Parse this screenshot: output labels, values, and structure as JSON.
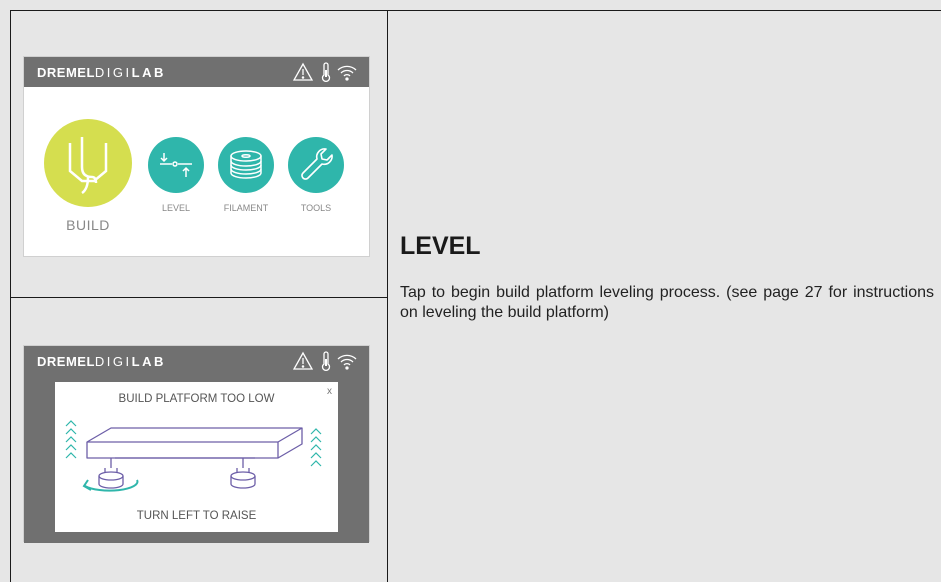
{
  "screen1": {
    "brand_bold": "DREMEL",
    "brand_mid": "DIGI",
    "brand_end": "LAB",
    "status_icons": [
      "warning-icon",
      "thermometer-icon",
      "wifi-icon"
    ],
    "build_label": "BUILD",
    "level_label": "LEVEL",
    "filament_label": "FILAMENT",
    "tools_label": "TOOLS",
    "colors": {
      "build": "#d5de4f",
      "accent": "#2fb6ab",
      "bar": "#707070"
    }
  },
  "screen2": {
    "brand_bold": "DREMEL",
    "brand_mid": "DIGI",
    "brand_end": "LAB",
    "dialog_title": "BUILD PLATFORM TOO LOW",
    "close_label": "x",
    "dialog_footer": "TURN LEFT TO RAISE",
    "colors": {
      "line": "#6d5fa8",
      "arrows": "#2fb6ab"
    }
  },
  "section": {
    "heading": "LEVEL",
    "description": "Tap to begin build platform leveling process. (see page 27 for instructions on leveling the build platform)"
  }
}
